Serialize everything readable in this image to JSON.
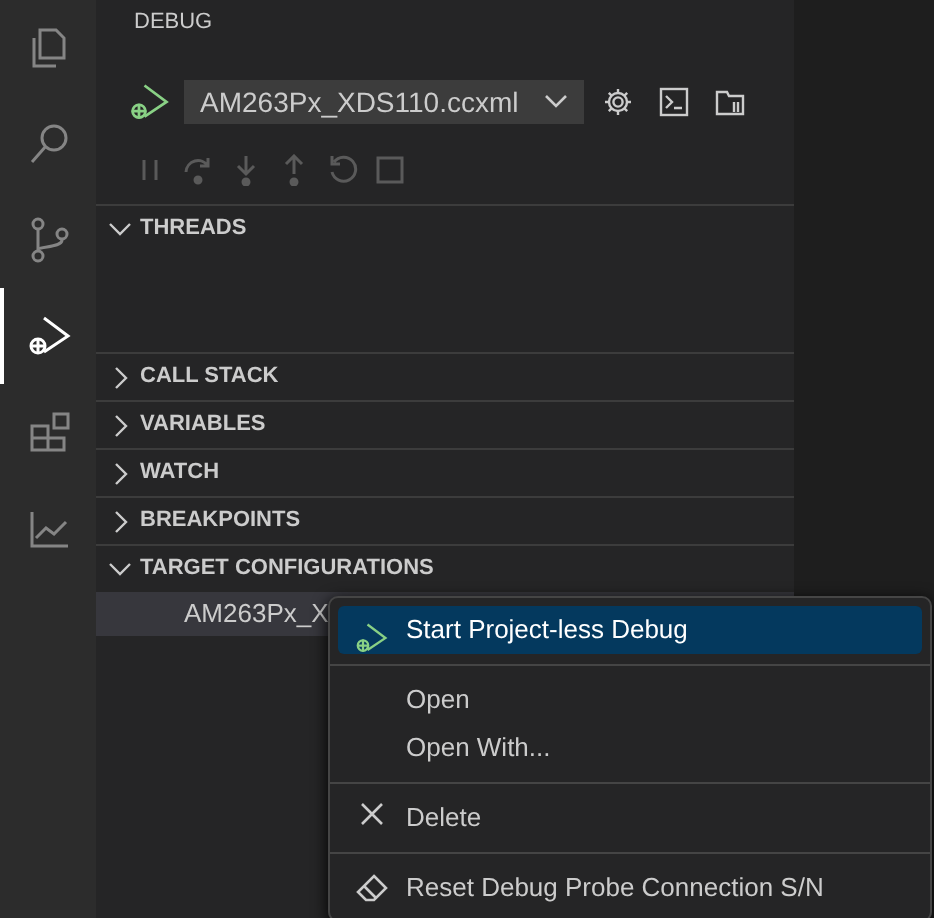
{
  "activity_bar": [
    {
      "selected": false
    },
    {
      "selected": false
    },
    {
      "selected": false
    },
    {
      "selected": true
    },
    {
      "selected": false
    },
    {
      "selected": false
    }
  ],
  "sidebar": {
    "title": "DEBUG",
    "launch_config": {
      "value": "AM263Px_XDS110.ccxml"
    },
    "debug_toolbar": [
      {
        "disabled": true
      },
      {
        "disabled": true
      },
      {
        "disabled": true
      },
      {
        "disabled": true
      },
      {
        "disabled": true
      },
      {
        "disabled": true
      }
    ],
    "sections": [
      {
        "label": "THREADS",
        "expanded": true
      },
      {
        "label": "CALL STACK",
        "expanded": false
      },
      {
        "label": "VARIABLES",
        "expanded": false
      },
      {
        "label": "WATCH",
        "expanded": false
      },
      {
        "label": "BREAKPOINTS",
        "expanded": false
      },
      {
        "label": "TARGET CONFIGURATIONS",
        "expanded": true,
        "items": [
          {
            "label": "AM263Px_X",
            "selected": true
          }
        ]
      }
    ]
  },
  "context_menu": [
    {
      "kind": "run",
      "label": "Start Project-less Debug",
      "selected": true
    },
    {
      "kind": "separator"
    },
    {
      "kind": "plain",
      "label": "Open",
      "selected": false
    },
    {
      "kind": "plain",
      "label": "Open With...",
      "selected": false
    },
    {
      "kind": "separator"
    },
    {
      "kind": "remove",
      "label": "Delete",
      "selected": false
    },
    {
      "kind": "separator"
    },
    {
      "kind": "erase",
      "label": "Reset Debug Probe Connection S/N",
      "selected": false
    }
  ]
}
